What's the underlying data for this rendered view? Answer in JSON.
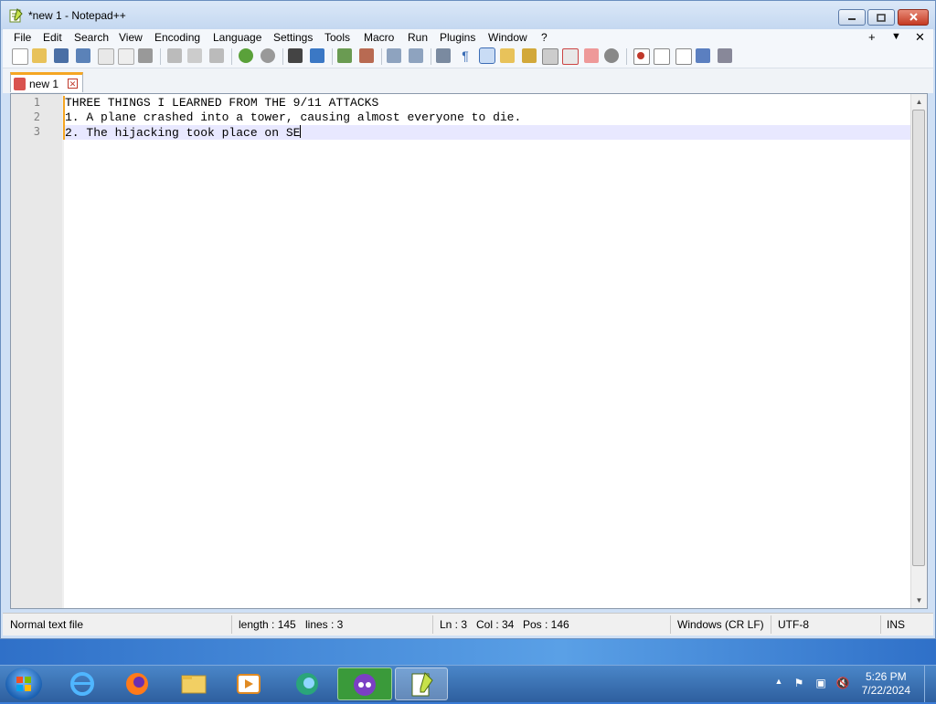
{
  "window": {
    "title": "*new 1 - Notepad++"
  },
  "menu": [
    "File",
    "Search",
    "View",
    "Encoding",
    "Language",
    "Settings",
    "Tools",
    "Macro",
    "Run",
    "Plugins",
    "Window",
    "?"
  ],
  "menu_first": "File",
  "menu_right": {
    "plus": "+",
    "down": "▼",
    "close": "✕"
  },
  "tab": {
    "label": "new 1",
    "close": "✕"
  },
  "editor": {
    "lines": [
      {
        "num": "1",
        "text": "THREE THINGS I LEARNED FROM THE 9/11 ATTACKS"
      },
      {
        "num": "2",
        "text": "1. A plane crashed into a tower, causing almost everyone to die."
      },
      {
        "num": "3",
        "text": "2. The hijacking took place on SE"
      }
    ]
  },
  "status": {
    "type": "Normal text file",
    "length": "length : 145",
    "lines": "lines : 3",
    "ln": "Ln : 3",
    "col": "Col : 34",
    "pos": "Pos : 146",
    "eol": "Windows (CR LF)",
    "encoding": "UTF-8",
    "mode": "INS"
  },
  "taskbar": {
    "time": "5:26 PM",
    "date": "7/22/2024"
  },
  "colors": {
    "accent": "#f5a623",
    "current_line": "#e8e8ff",
    "taskbar": "#2e5f9e"
  }
}
